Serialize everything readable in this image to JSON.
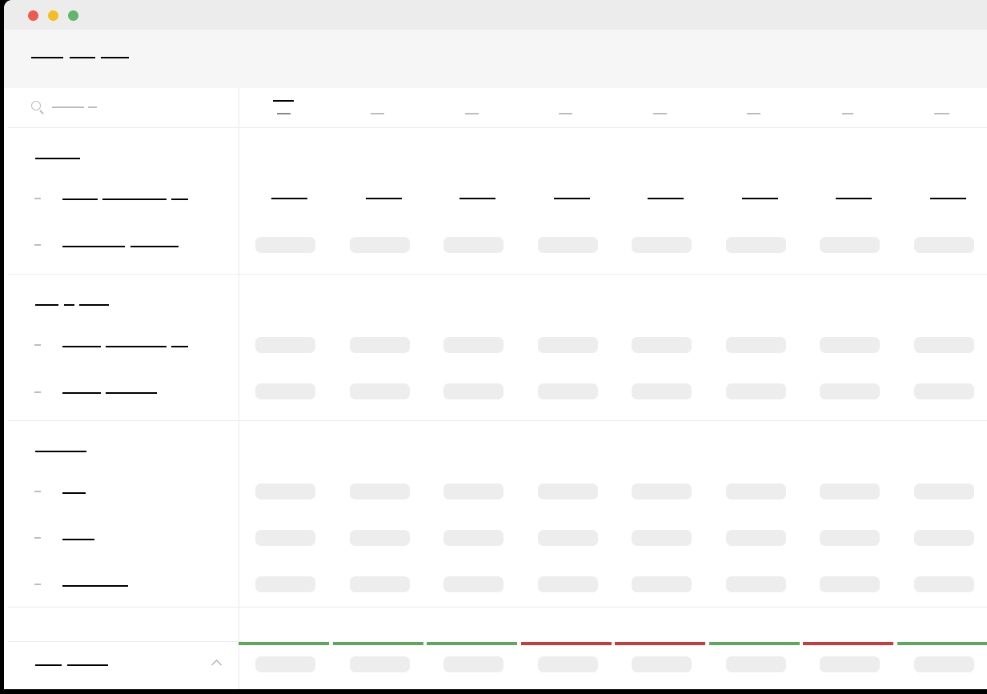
{
  "window": {
    "controls": [
      "close",
      "minimize",
      "zoom"
    ]
  },
  "header": {
    "title_words": [
      "",
      "",
      ""
    ]
  },
  "search": {
    "placeholder": ""
  },
  "sections": [
    {
      "title": "",
      "rows": [
        {
          "label": "",
          "cells": [
            "",
            "",
            "",
            "",
            "",
            "",
            "",
            ""
          ]
        },
        {
          "label": ""
        }
      ]
    },
    {
      "title": "",
      "rows": [
        {
          "label": ""
        },
        {
          "label": ""
        }
      ]
    },
    {
      "title": "",
      "rows": [
        {
          "label": ""
        },
        {
          "label": ""
        },
        {
          "label": ""
        }
      ]
    }
  ],
  "columns": [
    "",
    "",
    "",
    "",
    "",
    "",
    "",
    ""
  ],
  "status_colors": [
    "#5fa75f",
    "#5fa75f",
    "#5fa75f",
    "#cc3b3b",
    "#cc3b3b",
    "#5fa75f",
    "#cc3b3b",
    "#5fa75f"
  ],
  "footer": {
    "label": ""
  },
  "icons": [
    "search-icon",
    "chevron-up-icon"
  ]
}
